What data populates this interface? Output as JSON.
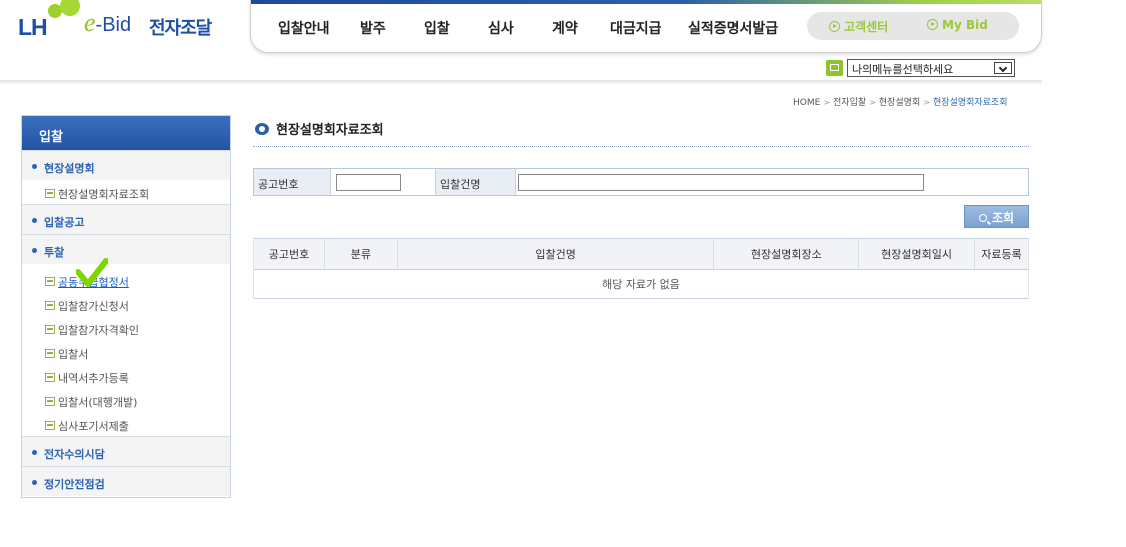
{
  "logo": {
    "lh": "LH",
    "e": "e",
    "bid": "-Bid",
    "name": "전자조달"
  },
  "gnb": {
    "menu": [
      "입찰안내",
      "발주",
      "입찰",
      "심사",
      "계약",
      "대금지급",
      "실적증명서발급"
    ],
    "quick": [
      "고객센터",
      "My Bid"
    ]
  },
  "my_menu": {
    "selected": "나의메뉴를선택하세요"
  },
  "breadcrumb": [
    "HOME",
    "전자입찰",
    "현장설명회",
    "현장설명회자료조회"
  ],
  "sidebar": {
    "title": "입찰",
    "categories": [
      "현장설명회",
      "입찰공고",
      "투찰",
      "전자수의시담",
      "정기안전점검"
    ],
    "sub_site": [
      "현장설명회자료조회"
    ],
    "sub_bid": [
      "공동수급협정서",
      "입찰참가신청서",
      "입찰참가자격확인",
      "입찰서",
      "내역서추가등록",
      "입찰서(대행개발)",
      "심사포기서제출"
    ]
  },
  "page_title": "현장설명회자료조회",
  "search": {
    "notice_no_label": "공고번호",
    "notice_no_value": "",
    "bid_name_label": "입찰건명",
    "bid_name_value": "",
    "button_label": "조회"
  },
  "table": {
    "headers": [
      "공고번호",
      "분류",
      "입찰건명",
      "현장설명회장소",
      "현장설명회일시",
      "자료등록"
    ],
    "empty_message": "해당 자료가 없음"
  },
  "colors": {
    "accent_blue": "#2d63b1",
    "accent_green": "#8fc52a",
    "checkmark": "#7ed600"
  }
}
